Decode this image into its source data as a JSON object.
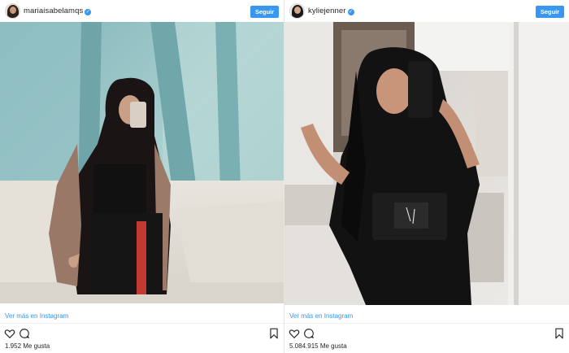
{
  "posts": [
    {
      "username": "mariaisabelamqs",
      "verified": true,
      "follow_label": "Seguir",
      "more_link": "Ver más en Instagram",
      "likes": "1.952 Me gusta"
    },
    {
      "username": "kyliejenner",
      "verified": true,
      "follow_label": "Seguir",
      "more_link": "Ver más en Instagram",
      "likes": "5.084.915 Me gusta"
    }
  ],
  "icons": {
    "like": "heart-icon",
    "comment": "comment-icon",
    "save": "bookmark-icon",
    "verified": "verified-badge-icon"
  },
  "colors": {
    "accent": "#3897f0",
    "text": "#262626"
  }
}
